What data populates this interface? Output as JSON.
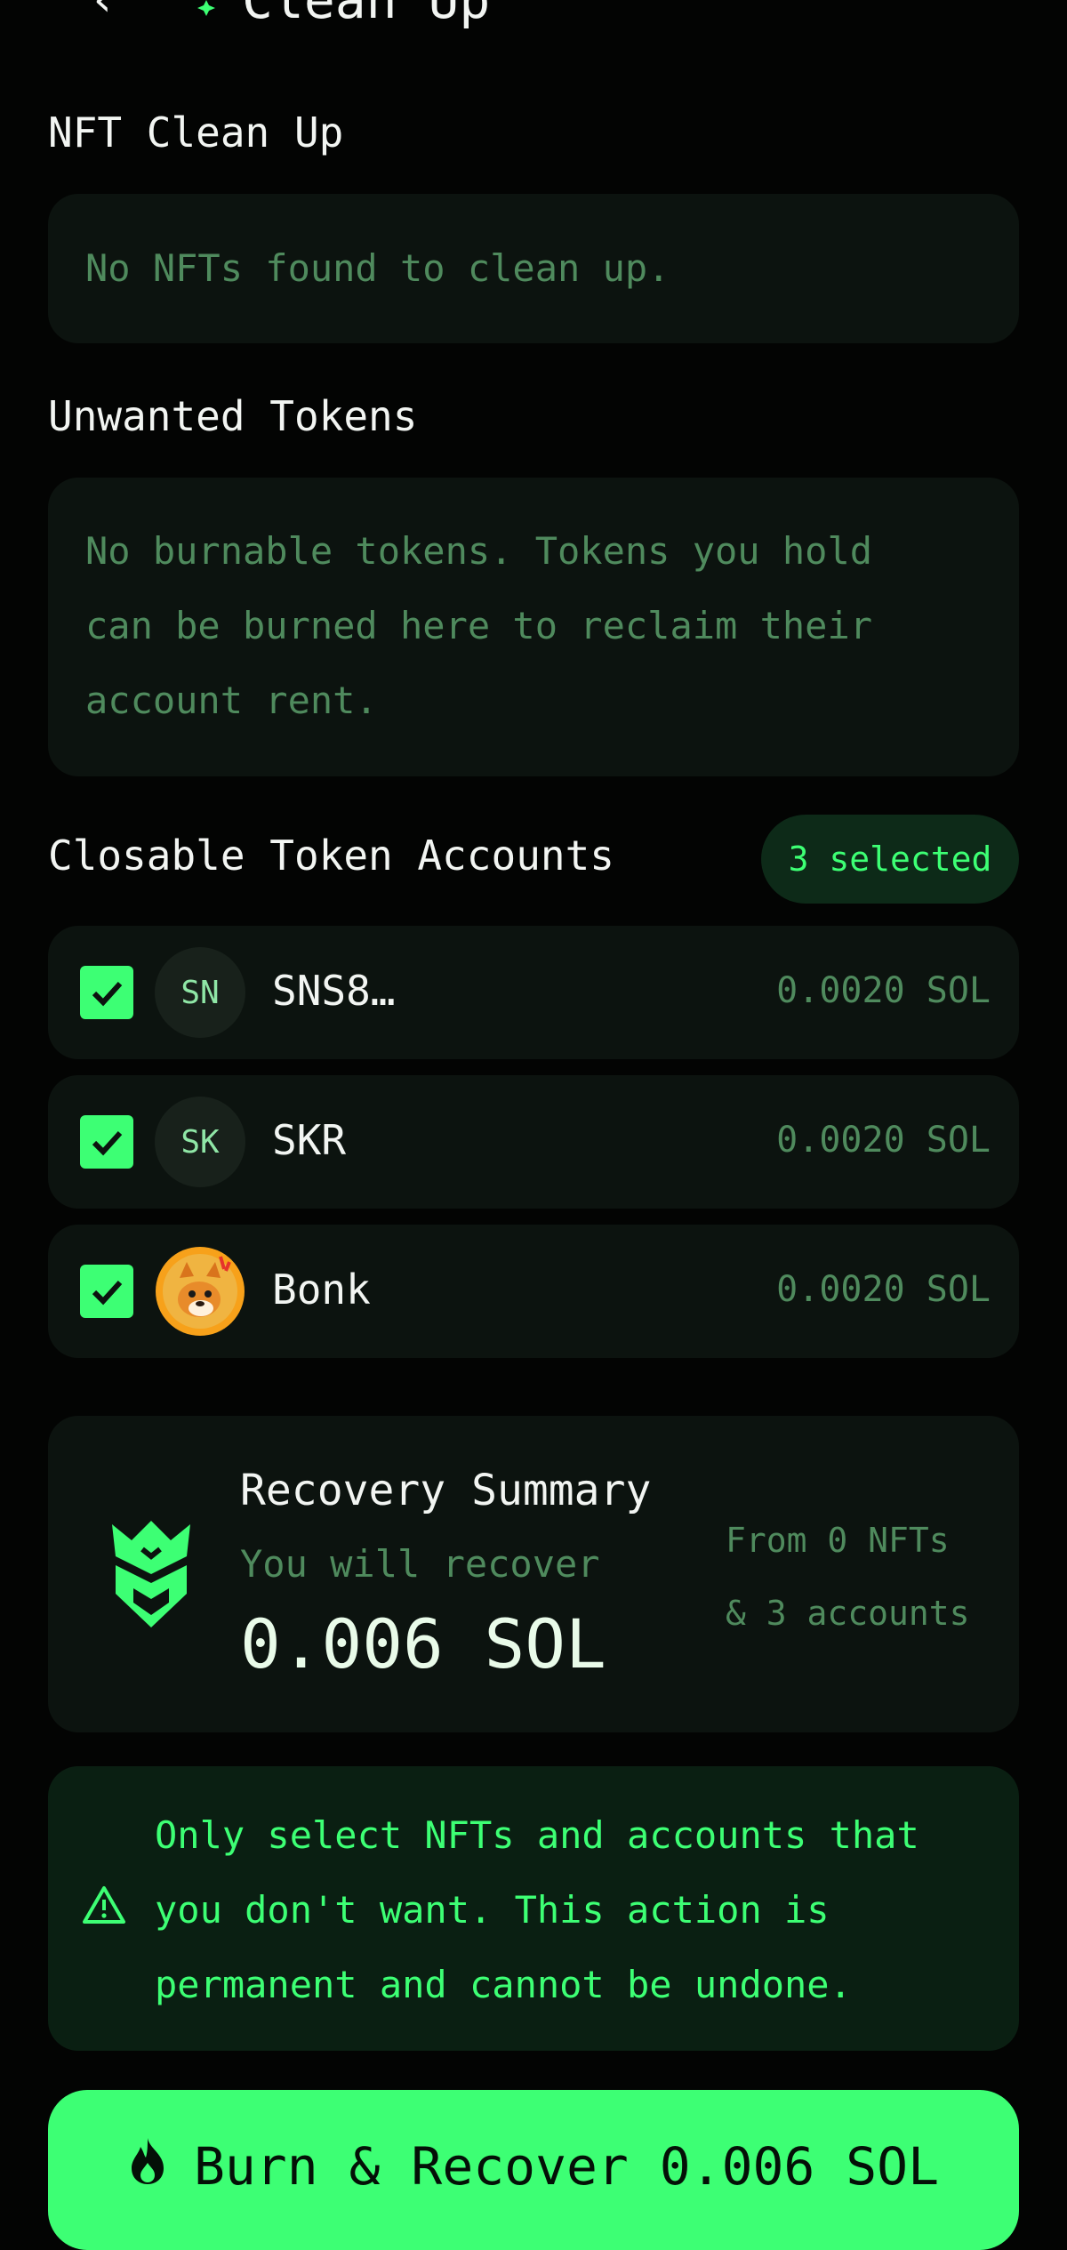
{
  "header": {
    "title": "Clean Up",
    "back_icon": "chevron-left-icon",
    "logo_icon": "sparkle-icon"
  },
  "nft_section": {
    "title": "NFT Clean Up",
    "empty_text": "No NFTs found to clean up."
  },
  "tokens_section": {
    "title": "Unwanted Tokens",
    "empty_lines": [
      "No burnable tokens. Tokens you hold",
      "can be burned here to reclaim their",
      "account rent."
    ]
  },
  "accounts_section": {
    "title": "Closable Token Accounts",
    "selected_badge": "3 selected",
    "items": [
      {
        "avatar_text": "SN",
        "name": "SNS8…",
        "value": "0.0020 SOL",
        "checked": true
      },
      {
        "avatar_text": "SK",
        "name": "SKR",
        "value": "0.0020 SOL",
        "checked": true
      },
      {
        "avatar_text": "",
        "name": "Bonk",
        "value": "0.0020 SOL",
        "checked": true,
        "avatar_icon": "bonk-dog-icon"
      }
    ]
  },
  "summary": {
    "icon": "shield-logo-icon",
    "title": "Recovery Summary",
    "subtitle": "You will recover",
    "amount": "0.006 SOL",
    "from_line1": "From 0 NFTs",
    "from_line2": "& 3 accounts"
  },
  "warning": {
    "icon": "warning-triangle-icon",
    "lines": [
      "Only select NFTs and accounts that",
      "you don't want. This action is",
      "permanent and cannot be undone."
    ]
  },
  "cta": {
    "icon": "flame-icon",
    "label": "Burn & Recover 0.006 SOL"
  },
  "colors": {
    "accent": "#3dff74",
    "card": "#0c130f",
    "muted": "#4f8a5d",
    "background": "#030403"
  }
}
